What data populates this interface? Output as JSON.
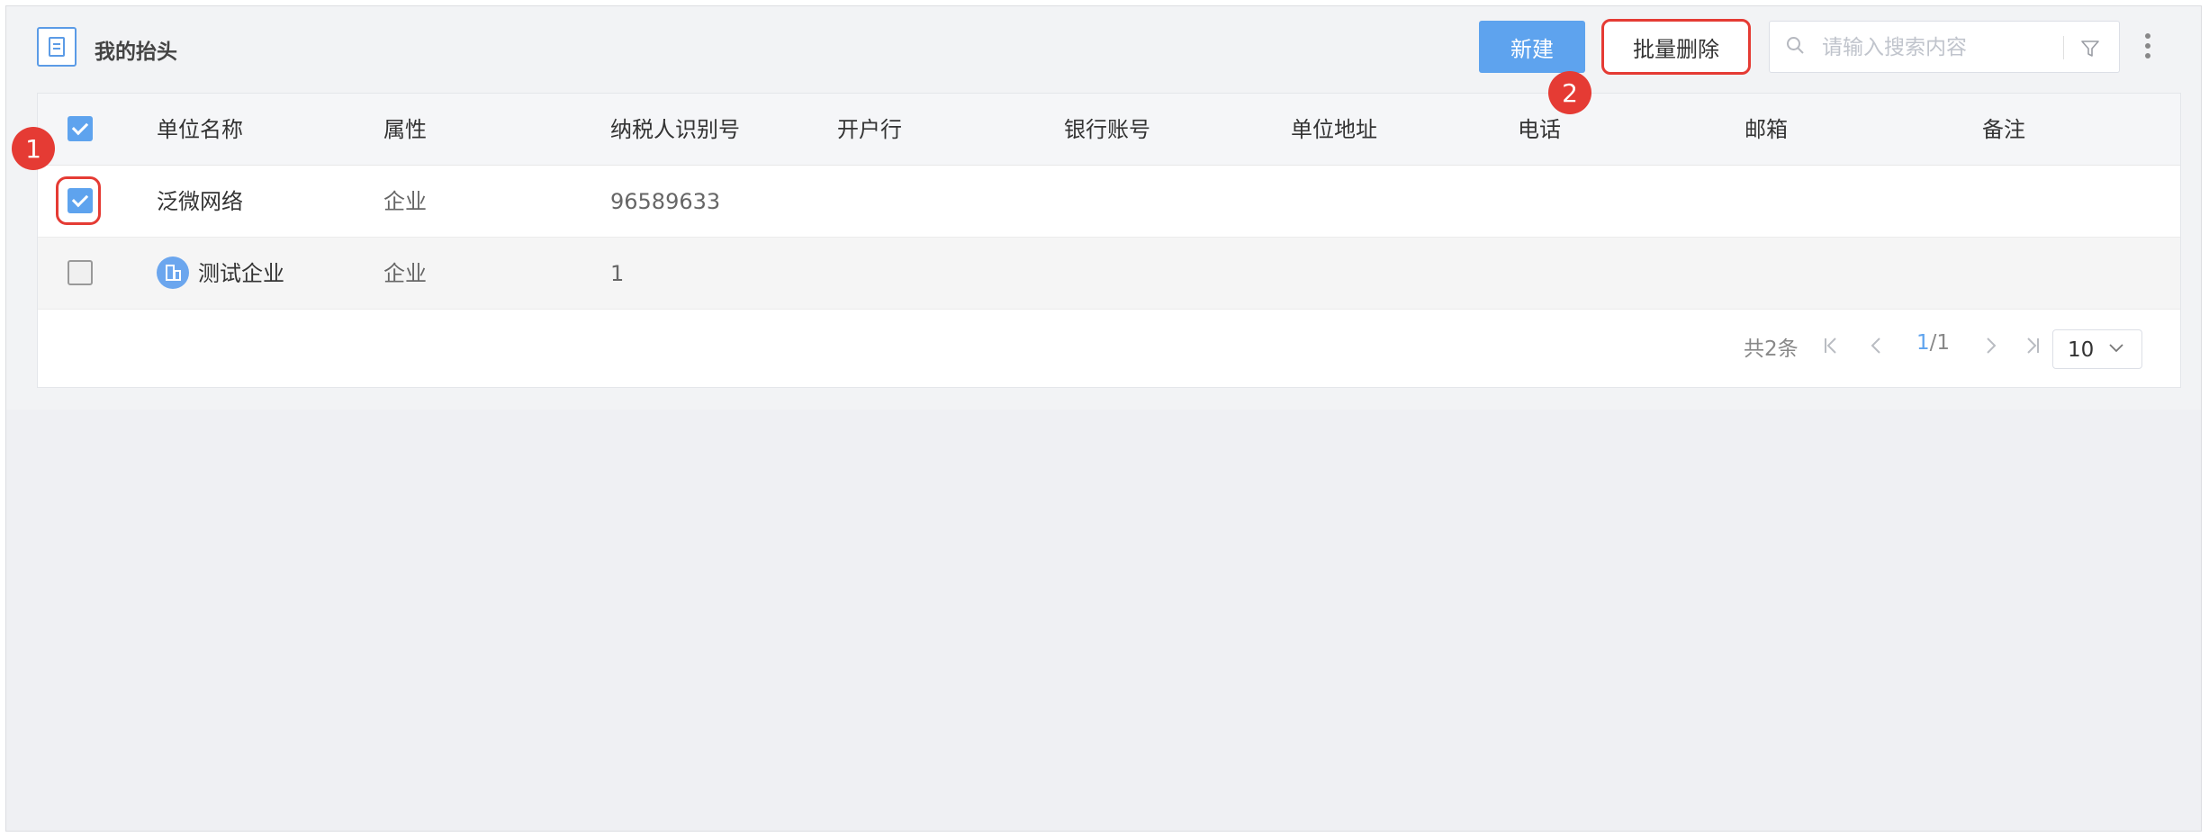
{
  "header": {
    "title": "我的抬头",
    "new_label": "新建",
    "batch_delete_label": "批量删除",
    "search_placeholder": "请输入搜索内容"
  },
  "table": {
    "columns": [
      "单位名称",
      "属性",
      "纳税人识别号",
      "开户行",
      "银行账号",
      "单位地址",
      "电话",
      "邮箱",
      "备注"
    ],
    "rows": [
      {
        "name": "泛微网络",
        "type": "企业",
        "tax_id": "96589633",
        "checked": true
      },
      {
        "name": "测试企业",
        "type": "企业",
        "tax_id": "1",
        "checked": false
      }
    ]
  },
  "pagination": {
    "total": "共2条",
    "current": "1",
    "total_pages": "/1",
    "page_size": "10"
  },
  "annotations": {
    "badge1": "1",
    "badge2": "2"
  },
  "colors": {
    "accent": "#5ea3ee",
    "annotation_red": "#e53b34"
  }
}
